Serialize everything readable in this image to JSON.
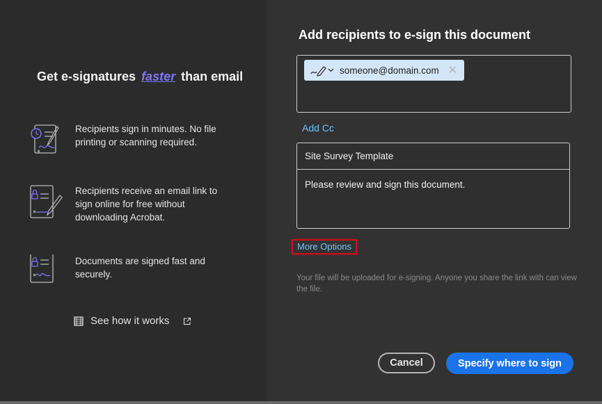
{
  "left_panel": {
    "headline_before": "Get e-signatures",
    "headline_accent": "faster",
    "headline_after": "than email",
    "features": [
      {
        "text": "Recipients sign in minutes. No file printing or scanning required.",
        "icon": "stopwatch-signature-icon"
      },
      {
        "text": "Recipients receive an email link to sign online for free without downloading Acrobat.",
        "icon": "lock-document-pen-icon"
      },
      {
        "text": "Documents are signed fast and securely.",
        "icon": "lock-document-signature-icon"
      }
    ],
    "see_how": "See how it works"
  },
  "right_panel": {
    "title": "Add recipients to e-sign this document",
    "recipient_chip": {
      "email": "someone@domain.com"
    },
    "add_cc": "Add Cc",
    "subject": "Site Survey Template",
    "message": "Please review and sign this document.",
    "more_options": "More Options",
    "note": "Your file will be uploaded for e-signing. Anyone you share the link with can view the file.",
    "cancel_label": "Cancel",
    "primary_label": "Specify where to sign"
  },
  "colors": {
    "accent_purple": "#7f74f5",
    "link_blue": "#6ec3ff",
    "primary_blue": "#1a73e8",
    "highlight_red": "#c8101e"
  }
}
